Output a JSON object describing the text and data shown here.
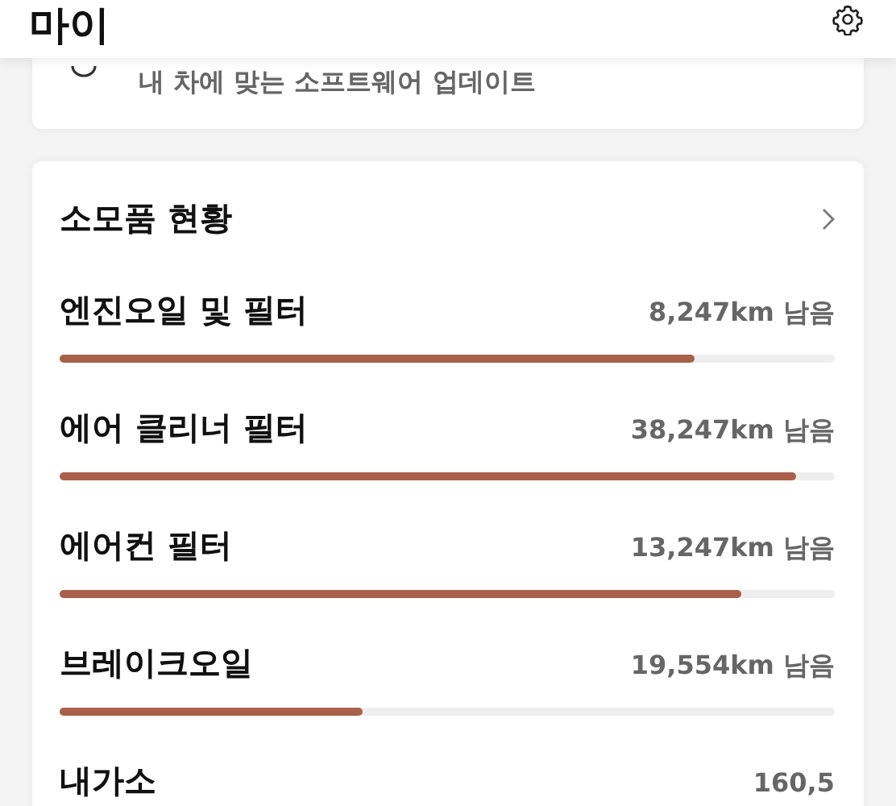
{
  "header": {
    "title": "마이"
  },
  "update_card": {
    "text": "내 차에 맞는 소프트웨어 업데이트"
  },
  "consumables": {
    "title": "소모품 현황",
    "items": [
      {
        "name": "엔진오일 및 필터",
        "reading": "8,247km 남음",
        "level": 0.82
      },
      {
        "name": "에어 클리너 필터",
        "reading": "38,247km 남음",
        "level": 0.95
      },
      {
        "name": "에어컨 필터",
        "reading": "13,247km 남음",
        "level": 0.88
      },
      {
        "name": "브레이크오일",
        "reading": "19,554km 남음",
        "level": 0.39
      },
      {
        "name": "내가소",
        "reading": "160,5"
      }
    ]
  }
}
